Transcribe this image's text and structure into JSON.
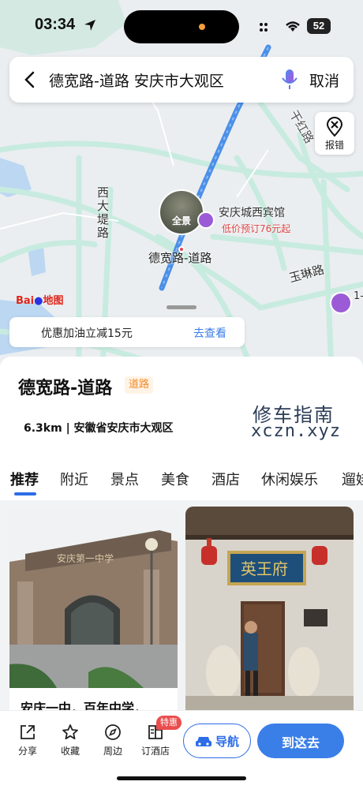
{
  "status_bar": {
    "time": "03:34",
    "battery": "52"
  },
  "search": {
    "query": "德宽路-道路 安庆市大观区",
    "cancel_label": "取消"
  },
  "map": {
    "report_label": "报错",
    "labels": {
      "xidadi": "西大堤路",
      "yulin": "玉琳路",
      "partial_road": "干红路",
      "hotel_name": "安庆城西宾馆",
      "hotel_promo": "低价预订76元起",
      "road_name": "德宽路-道路",
      "pano": "全景",
      "hotel_right": "1-"
    },
    "logo_left": "Bai",
    "logo_right": "地图",
    "promo_text": "优惠加油立减15元",
    "promo_link": "去查看"
  },
  "place": {
    "name": "德宽路-道路",
    "tag": "道路",
    "address": "6.3km | 安徽省安庆市大观区",
    "watermark_line1": "修车指南",
    "watermark_line2": "xczn.xyz"
  },
  "tabs": [
    "推荐",
    "附近",
    "景点",
    "美食",
    "酒店",
    "休闲娱乐",
    "遛娃"
  ],
  "cards": [
    {
      "caption": "安庆一中，百年中学，",
      "sign": "安庆第一中学"
    },
    {
      "caption": "",
      "sign": "英王府"
    }
  ],
  "bottom_nav": {
    "items": [
      {
        "label": "分享",
        "icon": "share-icon"
      },
      {
        "label": "收藏",
        "icon": "star-icon"
      },
      {
        "label": "周边",
        "icon": "compass-icon"
      },
      {
        "label": "订酒店",
        "icon": "hotel-book-icon"
      }
    ],
    "badge": "特惠",
    "navigate_label": "导航",
    "go_label": "到这去"
  },
  "colors": {
    "accent": "#3a7ee8",
    "route": "#4b8fe8",
    "road": "#c9ece0",
    "tag_orange": "#f08a24"
  }
}
